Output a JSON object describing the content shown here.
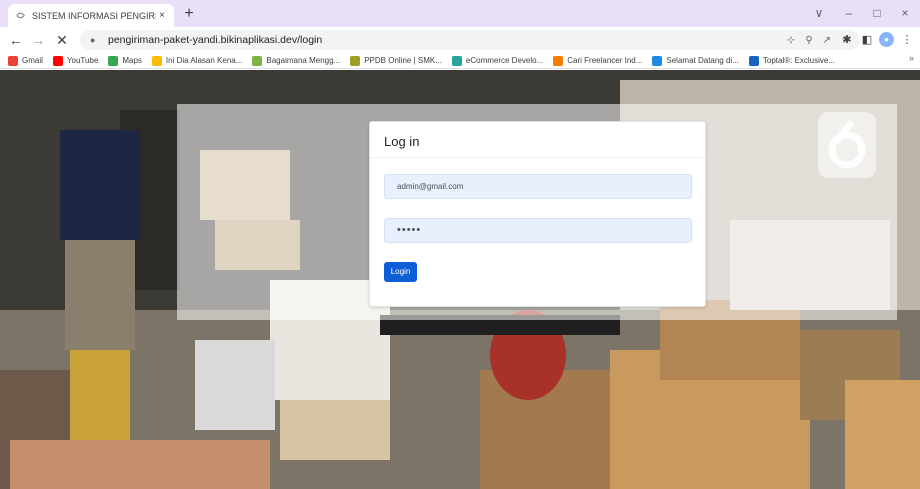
{
  "browser": {
    "tab_title": "SISTEM INFORMASI PENGIRIMA…",
    "tab_close": "×",
    "new_tab": "+",
    "url": "pengiriman-paket-yandi.bikinaplikasi.dev/login",
    "window_controls": [
      "∨",
      "–",
      "□",
      "×"
    ],
    "bookmarks": [
      {
        "label": "Gmail",
        "color": "#ea4335"
      },
      {
        "label": "YouTube",
        "color": "#ff0000"
      },
      {
        "label": "Maps",
        "color": "#34a853"
      },
      {
        "label": "Ini Dia Alasan Kena...",
        "color": "#fbbc05"
      },
      {
        "label": "Bagaimana Mengg...",
        "color": "#7cb342"
      },
      {
        "label": "PPDB Online | SMK...",
        "color": "#9e9d24"
      },
      {
        "label": "eCommerce Develo...",
        "color": "#26a69a"
      },
      {
        "label": "Cari Freelancer Ind...",
        "color": "#f57c00"
      },
      {
        "label": "Selamat Datang di...",
        "color": "#1e88e5"
      },
      {
        "label": "Toptal®: Exclusive...",
        "color": "#1565c0"
      }
    ],
    "bookmarks_more": "»"
  },
  "login": {
    "heading": "Log in",
    "email_value": "admin@gmail.com",
    "password_value": "•••••",
    "button_label": "Login"
  },
  "colors": {
    "button": "#0d5fd8",
    "field_bg": "#e8f0fe",
    "tabstrip": "#e9dff7"
  }
}
